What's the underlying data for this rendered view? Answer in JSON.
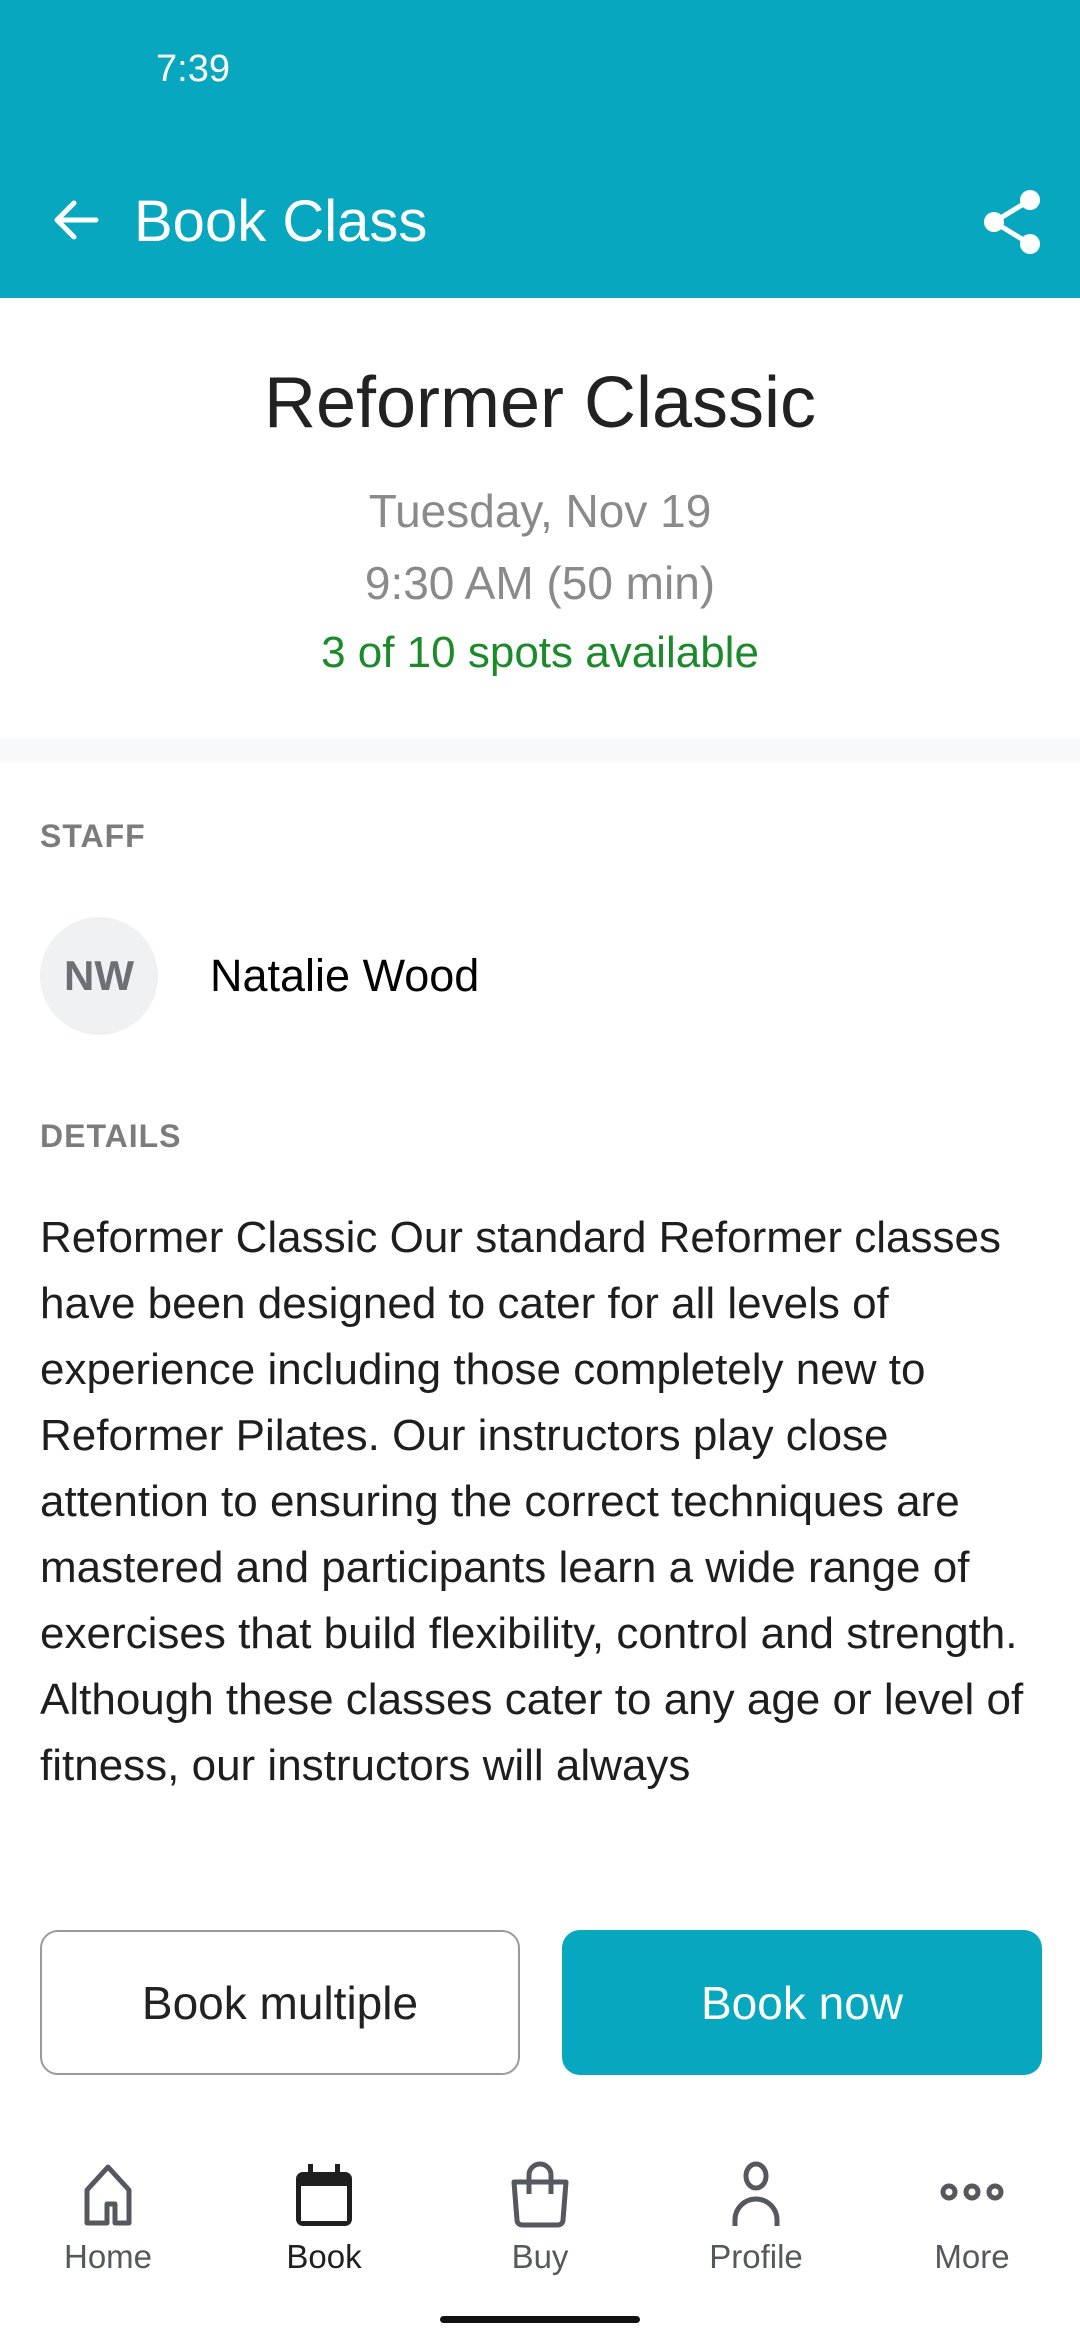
{
  "status_bar": {
    "time": "7:39"
  },
  "header": {
    "title": "Book Class",
    "back_icon": "arrow-left-icon",
    "share_icon": "share-icon"
  },
  "class_info": {
    "name": "Reformer Classic",
    "date": "Tuesday, Nov 19",
    "time": "9:30 AM (50 min)",
    "availability": "3 of 10 spots available"
  },
  "staff": {
    "section_label": "STAFF",
    "initials": "NW",
    "name": "Natalie Wood"
  },
  "details": {
    "section_label": "DETAILS",
    "text": "Reformer Classic Our standard Reformer classes have been designed to cater for all levels of experience including those completely new to Reformer Pilates. Our instructors play close attention to ensuring the correct techniques are mastered and participants learn a wide range of exercises that build flexibility, control and strength. Although these classes cater to any age or level of fitness, our instructors will always"
  },
  "actions": {
    "book_multiple": "Book multiple",
    "book_now": "Book now"
  },
  "bottom_nav": [
    {
      "label": "Home",
      "icon": "home-icon"
    },
    {
      "label": "Book",
      "icon": "calendar-icon",
      "active": true
    },
    {
      "label": "Buy",
      "icon": "shopping-bag-icon"
    },
    {
      "label": "Profile",
      "icon": "person-icon"
    },
    {
      "label": "More",
      "icon": "more-icon"
    }
  ],
  "colors": {
    "accent": "#07a8bf",
    "availability": "#1a8a2a"
  }
}
